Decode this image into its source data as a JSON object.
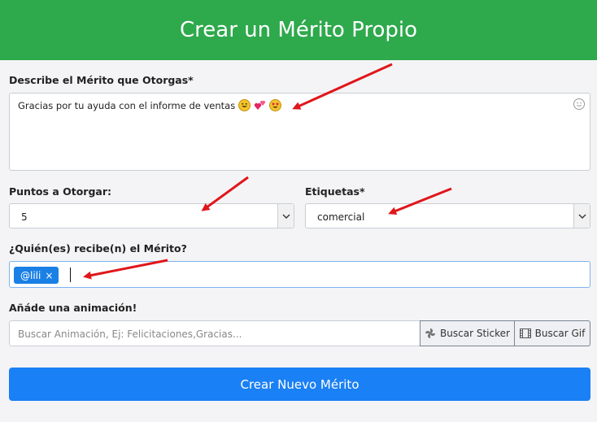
{
  "header": {
    "title": "Crear un Mérito Propio"
  },
  "description": {
    "label": "Describe el Mérito que Otorgas*",
    "value": "Gracias por tu ayuda con el informe de ventas",
    "emojis": [
      "grinning-face-emoji",
      "two-hearts-emoji",
      "star-struck-emoji"
    ]
  },
  "points": {
    "label": "Puntos a Otorgar:",
    "value": "5"
  },
  "tags": {
    "label": "Etiquetas*",
    "value": "comercial"
  },
  "recipients": {
    "label": "¿Quién(es) recibe(n) el Mérito?",
    "chips": [
      {
        "text": "@lili",
        "remove": "×"
      }
    ]
  },
  "animation": {
    "label": "Añáde una animación!",
    "placeholder": "Buscar Animación, Ej: Felicitaciones,Gracias...",
    "sticker_button": "Buscar Sticker",
    "gif_button": "Buscar Gif"
  },
  "submit": {
    "label": "Crear Nuevo Mérito"
  },
  "colors": {
    "header": "#2ea94c",
    "primary": "#1a80f5",
    "chip": "#1a80e5",
    "annotation_arrow": "#e0161b"
  }
}
